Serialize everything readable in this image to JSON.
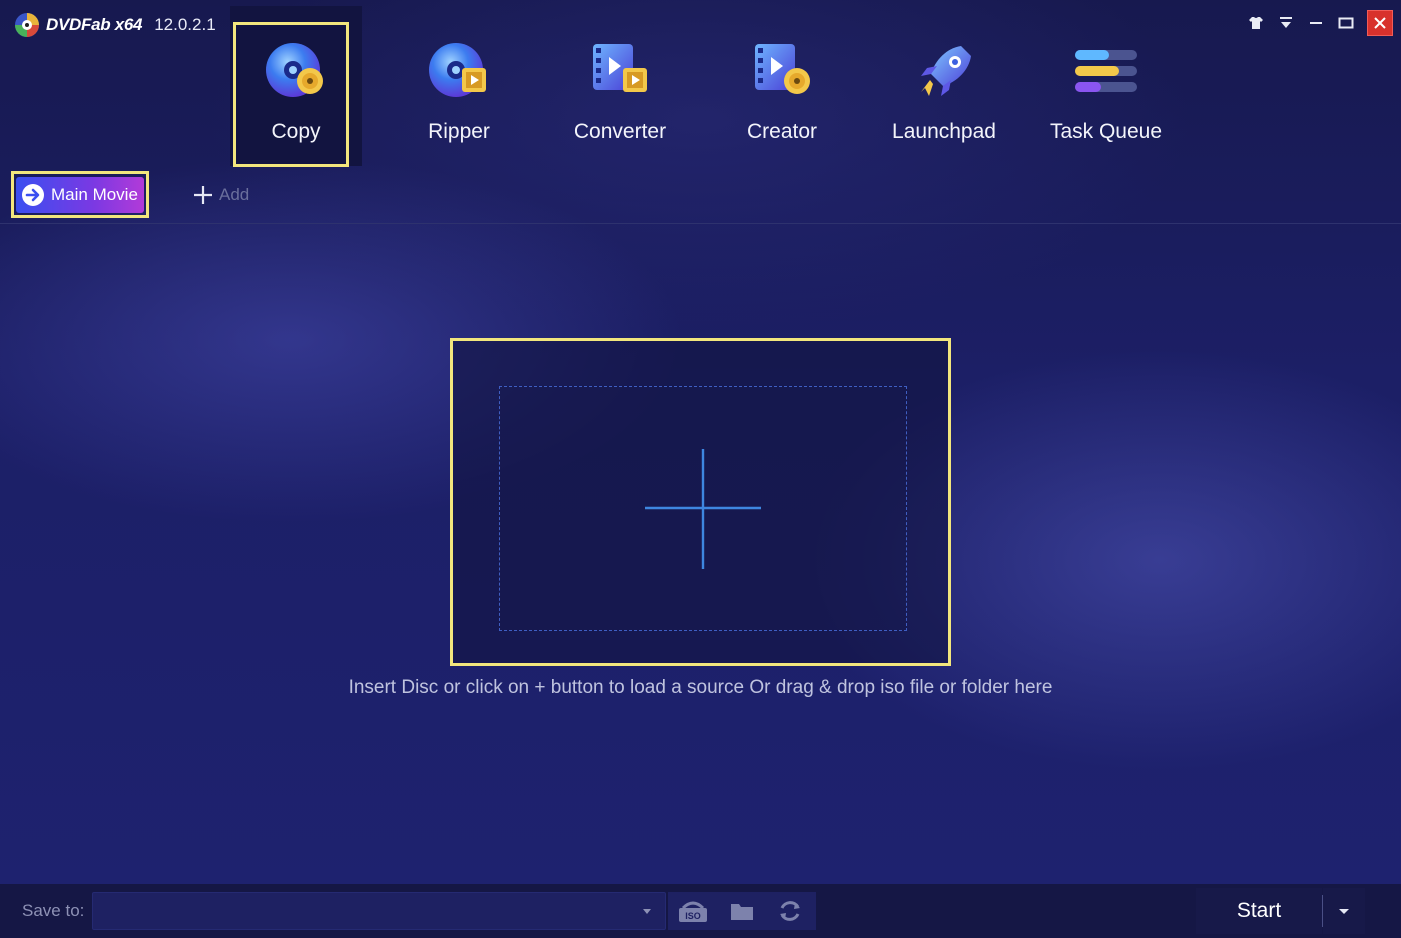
{
  "app": {
    "brand": "DVDFab x64",
    "version": "12.0.2.1"
  },
  "modules": [
    {
      "label": "Copy",
      "icon": "disc-copy-icon",
      "selected": true
    },
    {
      "label": "Ripper",
      "icon": "disc-film-icon"
    },
    {
      "label": "Converter",
      "icon": "film-convert-icon"
    },
    {
      "label": "Creator",
      "icon": "film-disc-icon"
    },
    {
      "label": "Launchpad",
      "icon": "rocket-icon"
    },
    {
      "label": "Task Queue",
      "icon": "task-queue-icon"
    }
  ],
  "toolbar": {
    "main_movie": "Main Movie",
    "add": "Add"
  },
  "dropzone": {
    "hint": "Insert Disc or click on + button to load a source Or drag & drop iso file or folder here"
  },
  "bottom": {
    "save_label": "Save to:",
    "save_value": "",
    "start": "Start"
  },
  "colors": {
    "highlight": "#f2e67d",
    "accent_start": "#3a4ff0",
    "accent_end": "#b23ad8",
    "close": "#d8312c"
  }
}
